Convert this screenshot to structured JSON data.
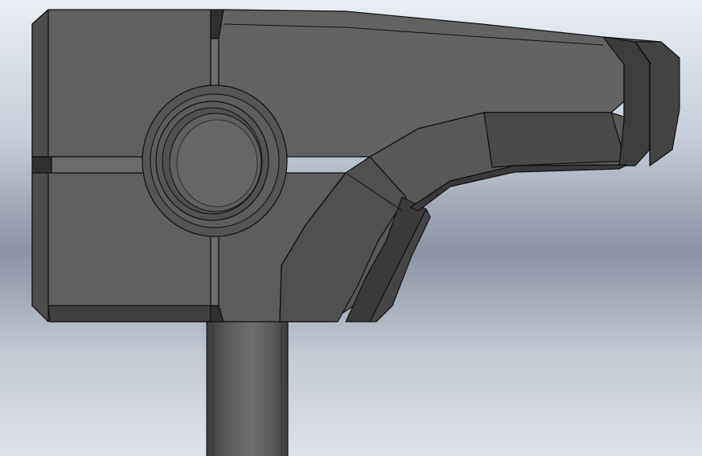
{
  "viewport": {
    "background_colors": [
      "#e9eef4",
      "#c7ced9",
      "#8a93a3",
      "#c3cad4",
      "#dfe3ea"
    ]
  },
  "model": {
    "body_color": "#5f5f5f",
    "face_light_color": "#6b6b6b",
    "face_dark_color": "#3f3f3f",
    "edge_color": "#111111",
    "shaft_color": "#575757"
  }
}
